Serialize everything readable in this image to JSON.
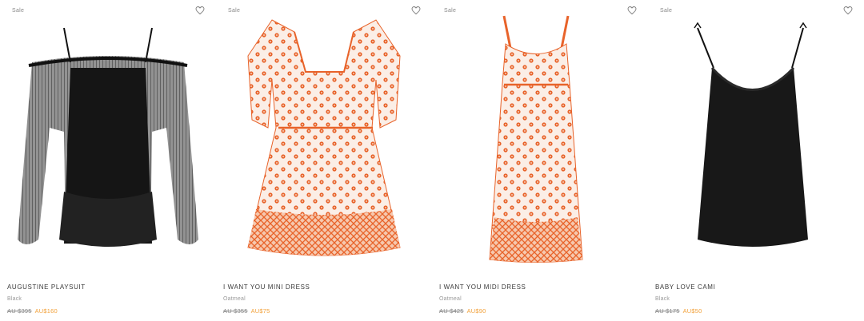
{
  "products": [
    {
      "badge": "Sale",
      "name": "AUGUSTINE PLAYSUIT",
      "color": "Black",
      "old_price": "AU $395",
      "sale_price": "AU$160",
      "image": "black-sheer-playsuit",
      "wishlist_icon": "heart-outline-icon"
    },
    {
      "badge": "Sale",
      "name": "I WANT YOU MINI DRESS",
      "color": "Oatmeal",
      "old_price": "AU $355",
      "sale_price": "AU$75",
      "image": "orange-floral-mini-dress",
      "wishlist_icon": "heart-outline-icon"
    },
    {
      "badge": "Sale",
      "name": "I WANT YOU MIDI DRESS",
      "color": "Oatmeal",
      "old_price": "AU $425",
      "sale_price": "AU$90",
      "image": "orange-floral-midi-dress",
      "wishlist_icon": "heart-outline-icon"
    },
    {
      "badge": "Sale",
      "name": "BABY LOVE CAMI",
      "color": "Black",
      "old_price": "AU $175",
      "sale_price": "AU$50",
      "image": "black-cami-top",
      "wishlist_icon": "heart-outline-icon"
    }
  ],
  "colors": {
    "sale_price": "#f2a13a",
    "strike_price": "#8a8a8a",
    "floral": "#e8632a",
    "fabric_black": "#1a1a1a"
  }
}
